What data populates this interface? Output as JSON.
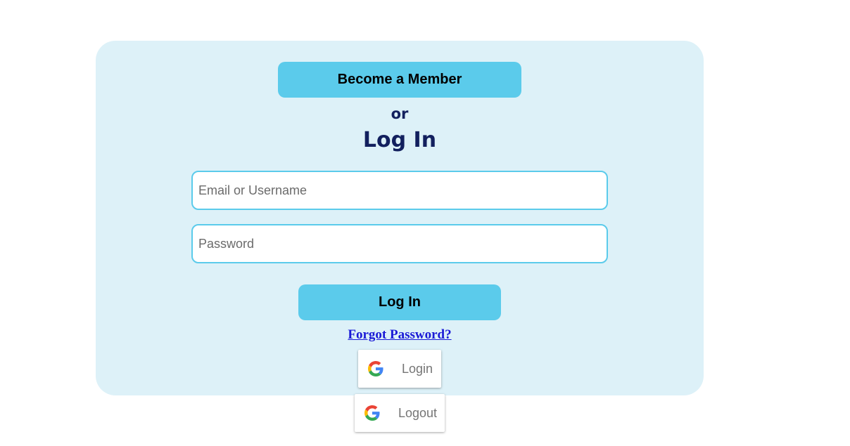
{
  "form": {
    "become_member_label": "Become a Member",
    "or_text": "or",
    "heading": "Log In",
    "email_placeholder": "Email or Username",
    "password_placeholder": "Password",
    "login_button_label": "Log In",
    "forgot_password_label": "Forgot Password?"
  },
  "google": {
    "login_label": "Login",
    "logout_label": "Logout",
    "icon": "google-g-icon"
  },
  "colors": {
    "card_background": "#ddf1f8",
    "button_background": "#5bcbeb",
    "heading_text": "#12205e",
    "link_text": "#1a1ad6"
  }
}
